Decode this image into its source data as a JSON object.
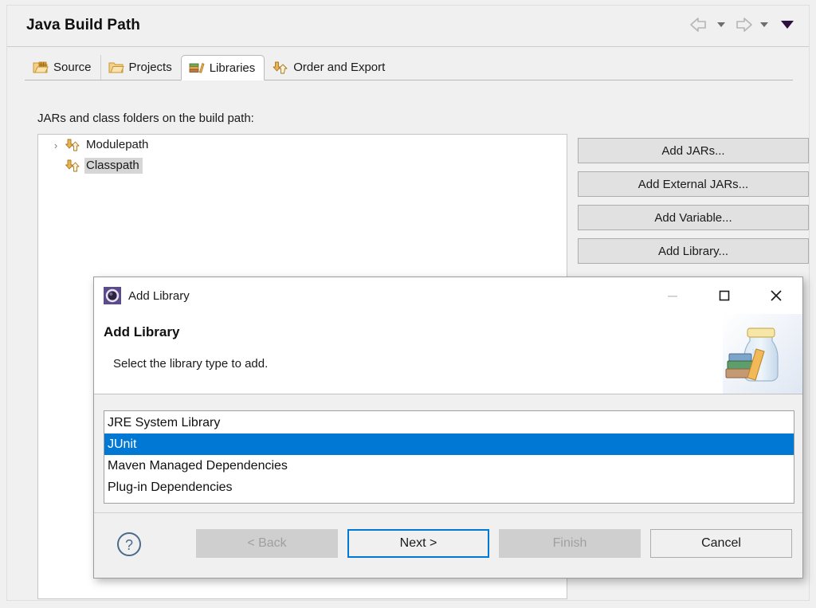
{
  "page": {
    "title": "Java Build Path",
    "nav": {
      "back_icon": "back-arrow-icon",
      "forward_icon": "forward-arrow-icon",
      "menu_icon": "view-menu-triangle-icon"
    },
    "tabs": [
      {
        "label": "Source",
        "icon": "source-folder-icon",
        "active": false
      },
      {
        "label": "Projects",
        "icon": "projects-folder-icon",
        "active": false
      },
      {
        "label": "Libraries",
        "icon": "libraries-books-icon",
        "active": true
      },
      {
        "label": "Order and Export",
        "icon": "order-export-arrows-icon",
        "active": false
      }
    ],
    "body_label": "JARs and class folders on the build path:",
    "tree": [
      {
        "label": "Modulepath",
        "icon": "path-arrows-icon",
        "expandable": true,
        "chevron": "›",
        "selected": false
      },
      {
        "label": "Classpath",
        "icon": "path-arrows-icon",
        "expandable": false,
        "chevron": "",
        "selected": true
      }
    ],
    "side_buttons": [
      "Add JARs...",
      "Add External JARs...",
      "Add Variable...",
      "Add Library..."
    ]
  },
  "dialog": {
    "window_title": "Add Library",
    "app_icon": "eclipse-logo-icon",
    "controls": {
      "minimize": "minimize-icon",
      "maximize": "maximize-icon",
      "close": "close-icon"
    },
    "heading": "Add Library",
    "subtitle": "Select the library type to add.",
    "banner_icon": "jar-with-books-icon",
    "list": [
      {
        "label": "JRE System Library",
        "selected": false
      },
      {
        "label": "JUnit",
        "selected": true
      },
      {
        "label": "Maven Managed Dependencies",
        "selected": false
      },
      {
        "label": "Plug-in Dependencies",
        "selected": false
      }
    ],
    "help_icon": "help-question-icon",
    "buttons": [
      {
        "label": "< Back",
        "state": "disabled"
      },
      {
        "label": "Next >",
        "state": "default"
      },
      {
        "label": "Finish",
        "state": "disabled"
      },
      {
        "label": "Cancel",
        "state": "normal"
      }
    ]
  },
  "colors": {
    "selection_blue": "#0078d4",
    "focus_blue": "#0078d4",
    "tree_selection_gray": "#d6d6d6",
    "panel_gray": "#f0f0f0",
    "button_gray": "#e1e1e1"
  }
}
